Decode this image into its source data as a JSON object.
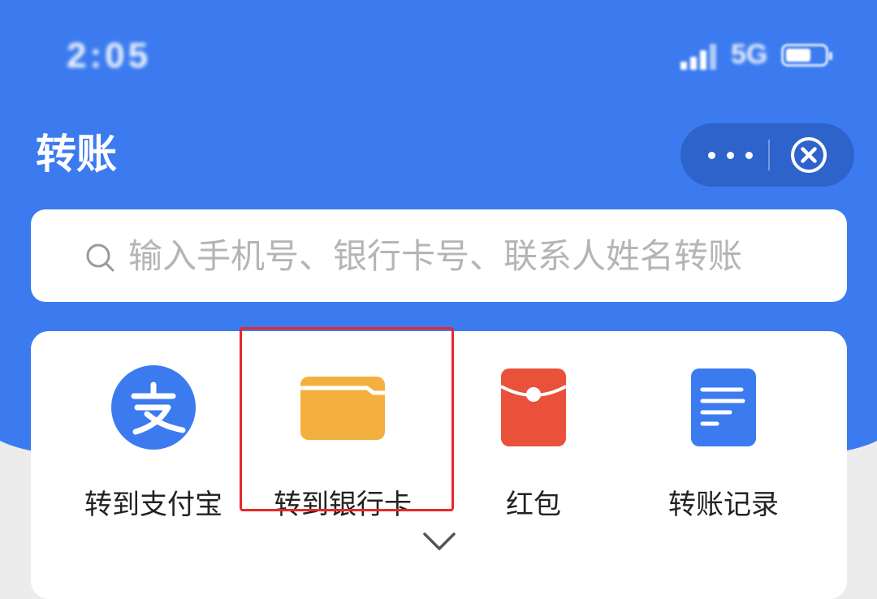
{
  "status_bar": {
    "time": "2:05",
    "network": "5G",
    "battery_level_percent": 65
  },
  "header": {
    "title": "转账",
    "more_icon": "more-dots-icon",
    "close_icon": "close-circle-icon"
  },
  "search": {
    "icon": "search-icon",
    "placeholder": "输入手机号、银行卡号、联系人姓名转账"
  },
  "quick_actions": [
    {
      "label": "转到支付宝",
      "icon": "alipay-icon",
      "color": "#3b7bef"
    },
    {
      "label": "转到银行卡",
      "icon": "bank-card-icon",
      "color": "#f4b03f"
    },
    {
      "label": "红包",
      "icon": "red-envelope-icon",
      "color": "#e9513b"
    },
    {
      "label": "转账记录",
      "icon": "document-list-icon",
      "color": "#3b7bef"
    }
  ],
  "expand_icon": "chevron-down-icon",
  "colors": {
    "primary": "#3b7bef",
    "capsule": "#2f63cc",
    "highlight": "#e8282a"
  }
}
